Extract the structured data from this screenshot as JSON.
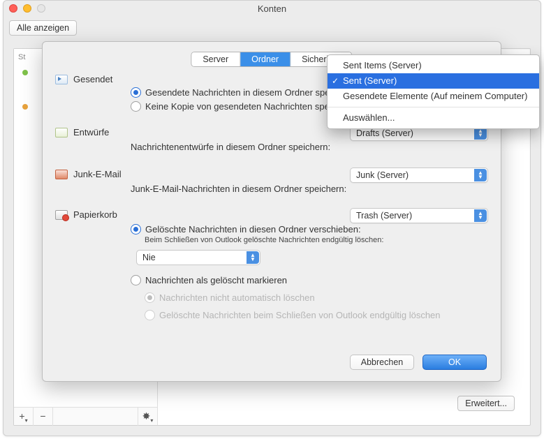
{
  "window": {
    "title": "Konten",
    "show_all_label": "Alle anzeigen",
    "sidebar_header": "St",
    "advanced_btn": "Erweitert..."
  },
  "tabs": {
    "server": "Server",
    "folders": "Ordner",
    "security": "Sicherheit"
  },
  "sections": {
    "sent": {
      "title": "Gesendet",
      "radio_store": "Gesendete Nachrichten in diesem Ordner speichern:",
      "radio_nosave": "Keine Kopie von gesendeten Nachrichten speichern"
    },
    "drafts": {
      "title": "Entwürfe",
      "popup_value": "Drafts (Server)",
      "desc": "Nachrichtenentwürfe in diesem Ordner speichern:"
    },
    "junk": {
      "title": "Junk-E-Mail",
      "popup_value": "Junk (Server)",
      "desc": "Junk-E-Mail-Nachrichten in diesem Ordner speichern:"
    },
    "trash": {
      "title": "Papierkorb",
      "popup_value": "Trash (Server)",
      "radio_move": "Gelöschte Nachrichten in diesen Ordner verschieben:",
      "sub_desc": "Beim Schließen von Outlook gelöschte Nachrichten endgültig löschen:",
      "schedule_value": "Nie",
      "radio_mark": "Nachrichten als gelöscht markieren",
      "disabled1": "Nachrichten nicht automatisch löschen",
      "disabled2": "Gelöschte Nachrichten beim Schließen von Outlook endgültig löschen"
    }
  },
  "dropdown": {
    "item1": "Sent Items (Server)",
    "item2": "Sent (Server)",
    "item3": "Gesendete Elemente (Auf meinem Computer)",
    "item4": "Auswählen..."
  },
  "buttons": {
    "cancel": "Abbrechen",
    "ok": "OK"
  }
}
